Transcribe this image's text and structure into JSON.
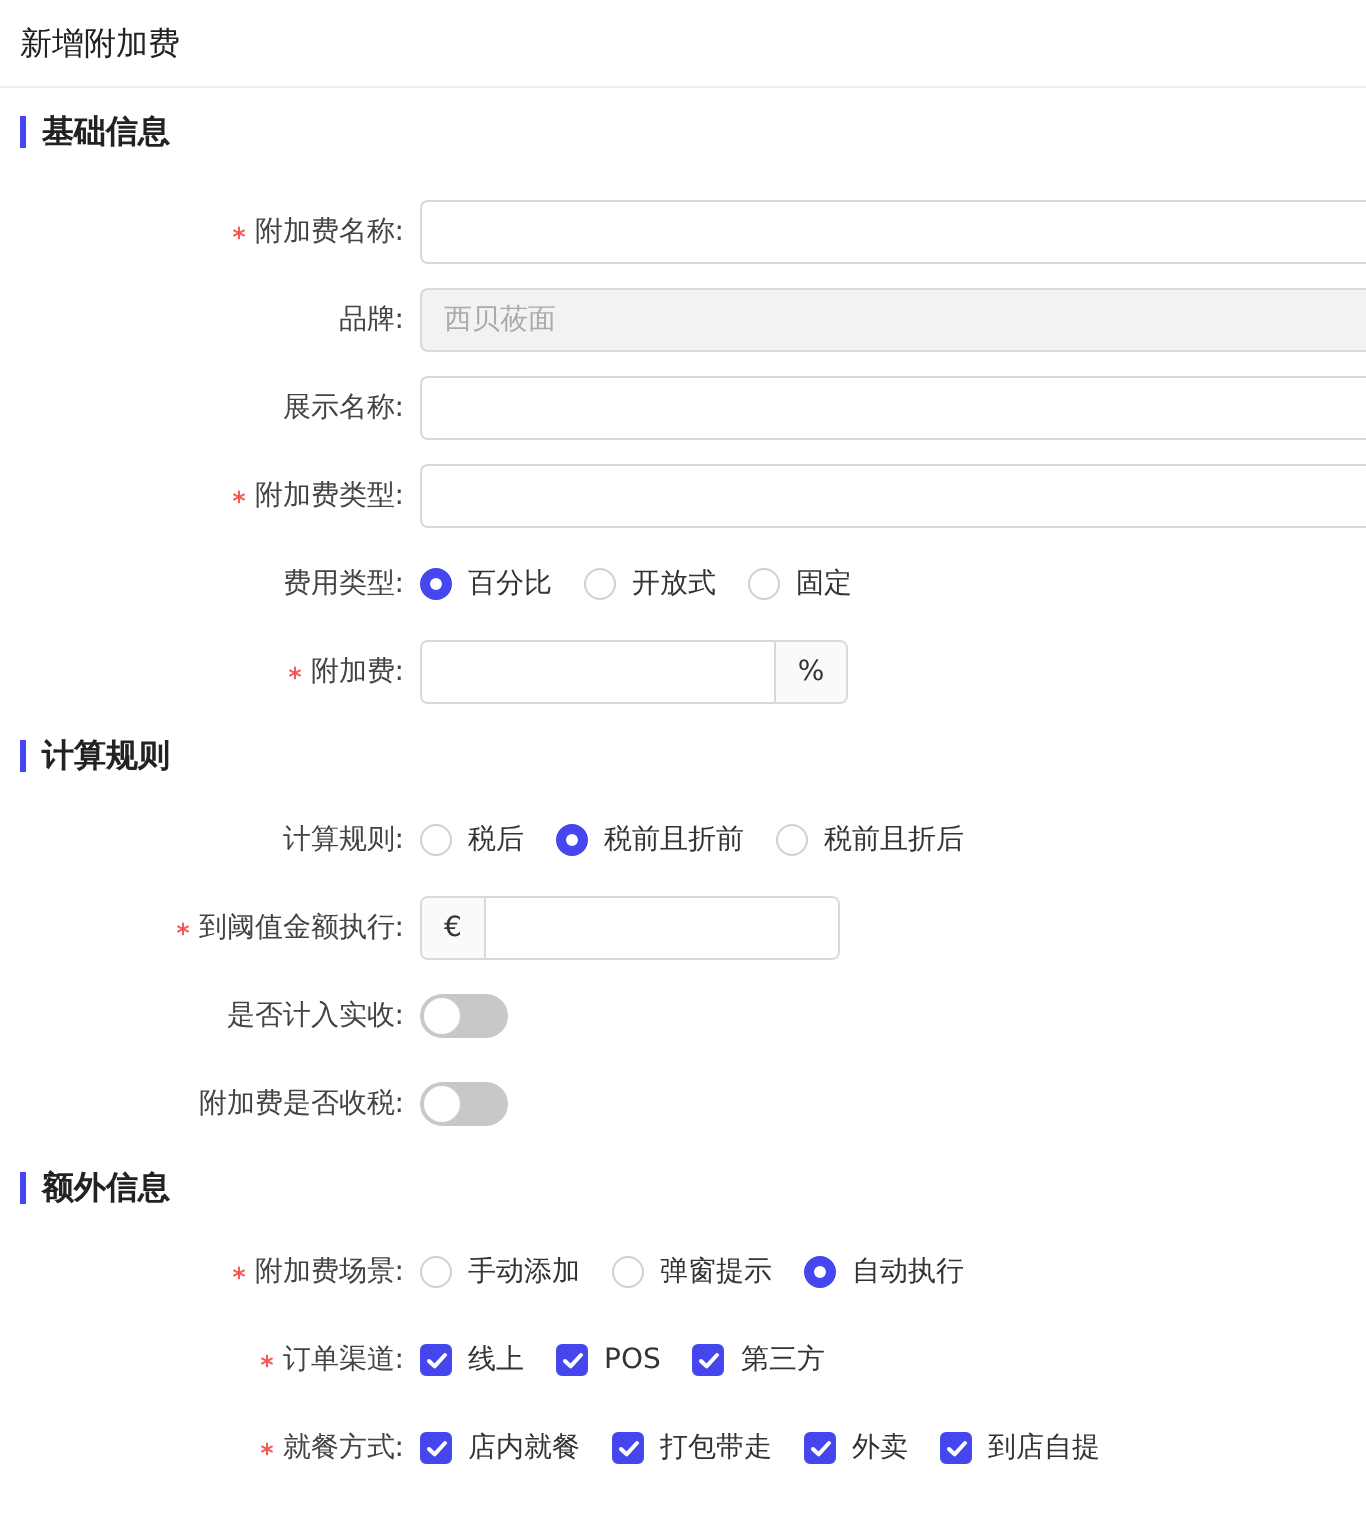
{
  "header": {
    "title": "新增附加费"
  },
  "sections": [
    {
      "title": "基础信息",
      "fields": [
        {
          "kind": "text",
          "label": "附加费名称:",
          "required": true
        },
        {
          "kind": "text",
          "label": "品牌:",
          "required": false,
          "disabled": true,
          "value": "西贝莜面"
        },
        {
          "kind": "text",
          "label": "展示名称:",
          "required": false
        },
        {
          "kind": "text",
          "label": "附加费类型:",
          "required": true
        },
        {
          "kind": "radio",
          "label": "费用类型:",
          "required": false,
          "options": [
            {
              "label": "百分比",
              "selected": true
            },
            {
              "label": "开放式",
              "selected": false
            },
            {
              "label": "固定",
              "selected": false
            }
          ]
        },
        {
          "kind": "suffix",
          "label": "附加费:",
          "required": true,
          "addon": "%"
        }
      ]
    },
    {
      "title": "计算规则",
      "fields": [
        {
          "kind": "radio",
          "label": "计算规则:",
          "required": false,
          "options": [
            {
              "label": "税后",
              "selected": false
            },
            {
              "label": "税前且折前",
              "selected": true
            },
            {
              "label": "税前且折后",
              "selected": false
            }
          ]
        },
        {
          "kind": "prefix",
          "label": "到阈值金额执行:",
          "required": true,
          "addon": "€"
        },
        {
          "kind": "switch",
          "label": "是否计入实收:",
          "required": false,
          "on": false
        },
        {
          "kind": "switch",
          "label": "附加费是否收税:",
          "required": false,
          "on": false
        }
      ]
    },
    {
      "title": "额外信息",
      "fields": [
        {
          "kind": "radio",
          "label": "附加费场景:",
          "required": true,
          "options": [
            {
              "label": "手动添加",
              "selected": false
            },
            {
              "label": "弹窗提示",
              "selected": false
            },
            {
              "label": "自动执行",
              "selected": true
            }
          ]
        },
        {
          "kind": "checkbox",
          "label": "订单渠道:",
          "required": true,
          "options": [
            {
              "label": "线上",
              "checked": true
            },
            {
              "label": "POS",
              "checked": true
            },
            {
              "label": "第三方",
              "checked": true
            }
          ]
        },
        {
          "kind": "checkbox",
          "label": "就餐方式:",
          "required": true,
          "options": [
            {
              "label": "店内就餐",
              "checked": true
            },
            {
              "label": "打包带走",
              "checked": true
            },
            {
              "label": "外卖",
              "checked": true
            },
            {
              "label": "到店自提",
              "checked": true
            }
          ]
        }
      ]
    }
  ]
}
